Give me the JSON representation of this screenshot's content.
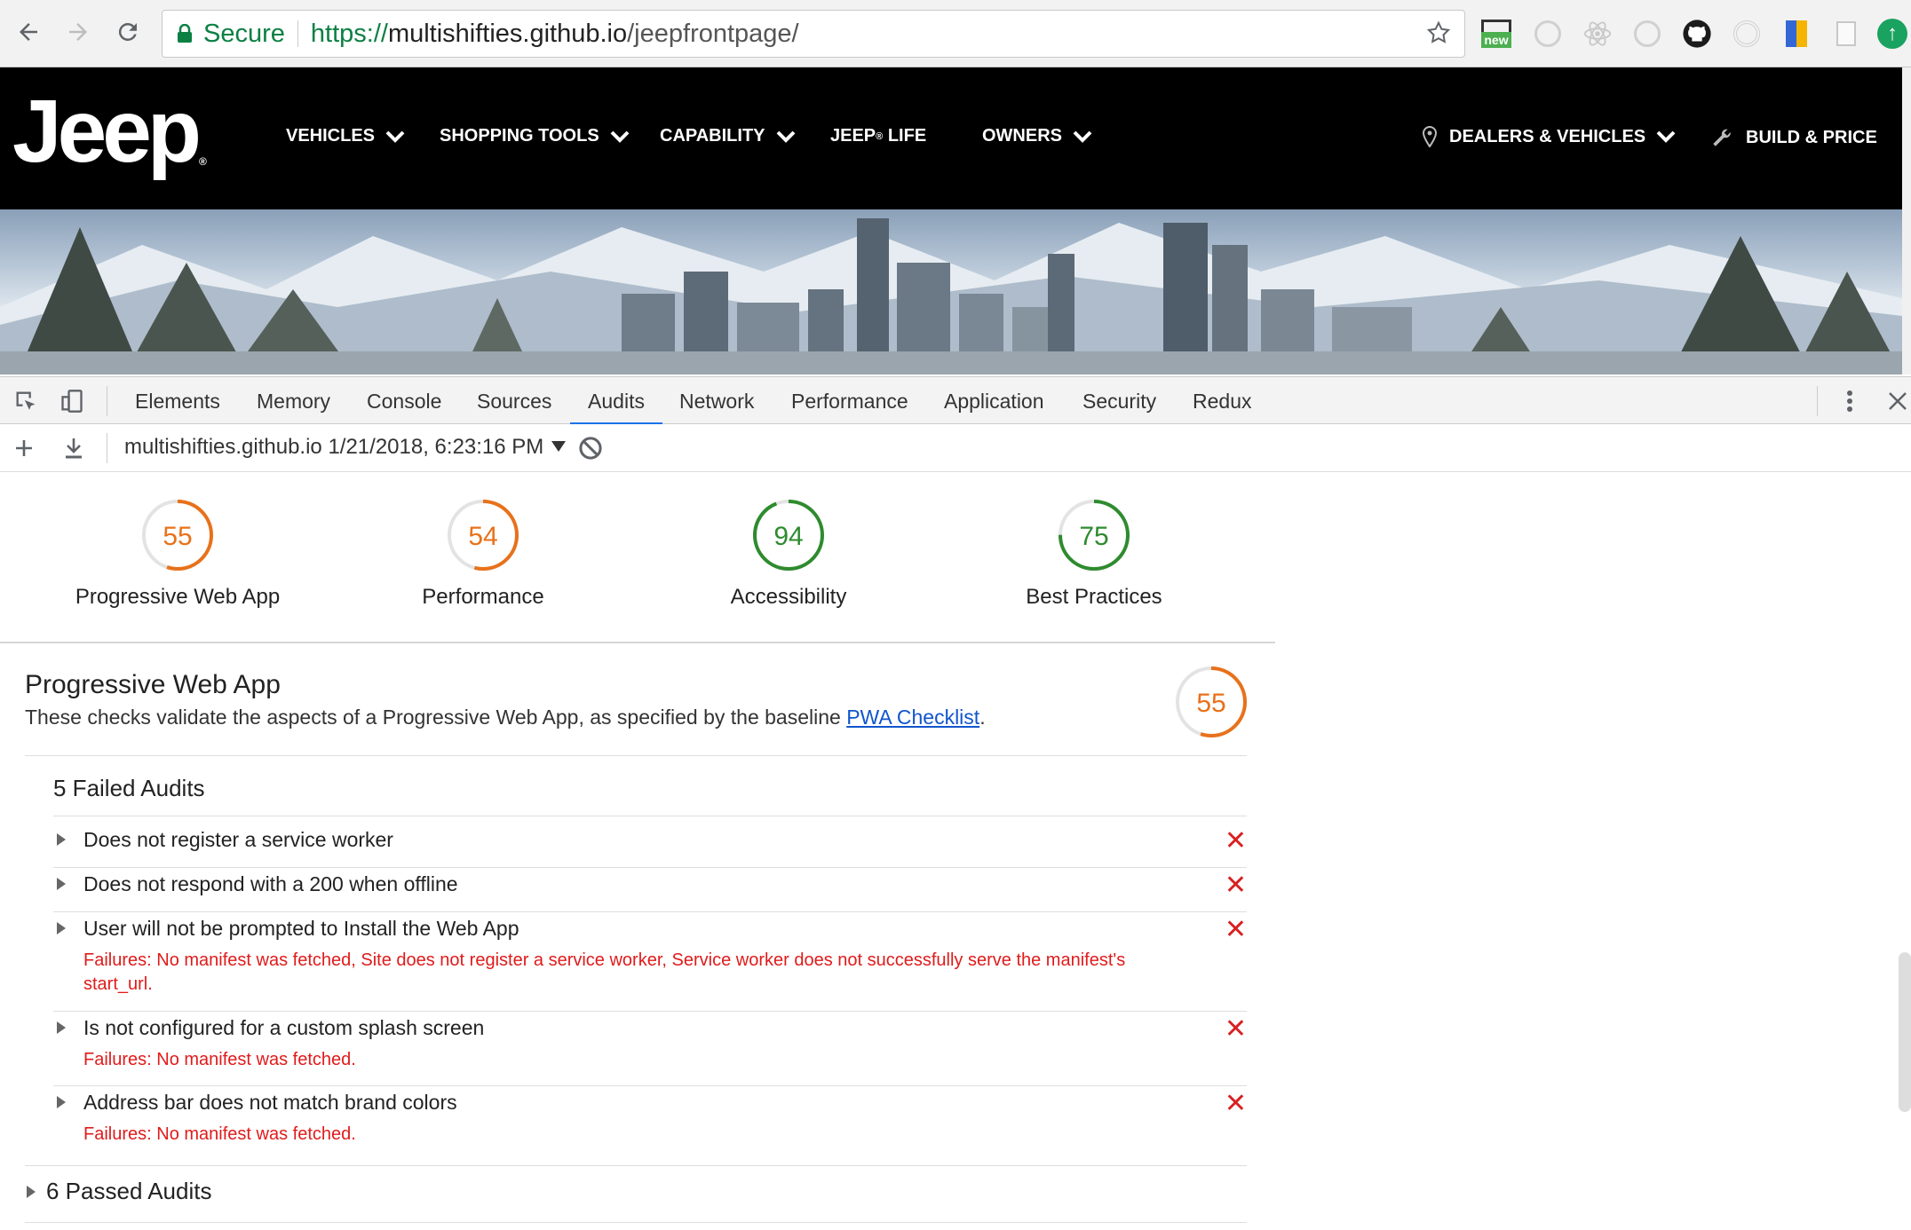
{
  "browser": {
    "secure_label": "Secure",
    "url_scheme": "https://",
    "url_host": "multishifties.github.io",
    "url_path": "/jeepfrontpage/",
    "extension_badge": "new"
  },
  "jeep": {
    "logo": "Jeep",
    "nav": {
      "vehicles": "VEHICLES",
      "shopping_tools": "SHOPPING TOOLS",
      "capability": "CAPABILITY",
      "jeep_life_a": "JEEP",
      "jeep_life_reg": "®",
      "jeep_life_b": " LIFE",
      "owners": "OWNERS",
      "dealers": "DEALERS & VEHICLES",
      "build": "BUILD & PRICE"
    }
  },
  "devtools": {
    "tabs": {
      "elements": "Elements",
      "memory": "Memory",
      "console": "Console",
      "sources": "Sources",
      "audits": "Audits",
      "network": "Network",
      "performance": "Performance",
      "application": "Application",
      "security": "Security",
      "redux": "Redux"
    },
    "report_label": "multishifties.github.io 1/21/2018, 6:23:16 PM",
    "accent_color": "#1a73e8"
  },
  "scores": [
    {
      "label": "Progressive Web App",
      "value": "55",
      "fraction": 0.55,
      "color": "#e8711a"
    },
    {
      "label": "Performance",
      "value": "54",
      "fraction": 0.54,
      "color": "#e8711a"
    },
    {
      "label": "Accessibility",
      "value": "94",
      "fraction": 0.94,
      "color": "#2e8b2e"
    },
    {
      "label": "Best Practices",
      "value": "75",
      "fraction": 0.75,
      "color": "#2e8b2e"
    }
  ],
  "pwa_section": {
    "title": "Progressive Web App",
    "description": "These checks validate the aspects of a Progressive Web App, as specified by the baseline ",
    "link_text": "PWA Checklist",
    "period": ".",
    "score": "55",
    "failed_title": "5 Failed Audits",
    "audits": [
      {
        "title": "Does not register a service worker",
        "failure": ""
      },
      {
        "title": "Does not respond with a 200 when offline",
        "failure": ""
      },
      {
        "title": "User will not be prompted to Install the Web App",
        "failure": "Failures: No manifest was fetched, Site does not register a service worker, Service worker does not successfully serve the manifest's start_url."
      },
      {
        "title": "Is not configured for a custom splash screen",
        "failure": "Failures: No manifest was fetched."
      },
      {
        "title": "Address bar does not match brand colors",
        "failure": "Failures: No manifest was fetched."
      }
    ],
    "passed_title": "6 Passed Audits"
  }
}
